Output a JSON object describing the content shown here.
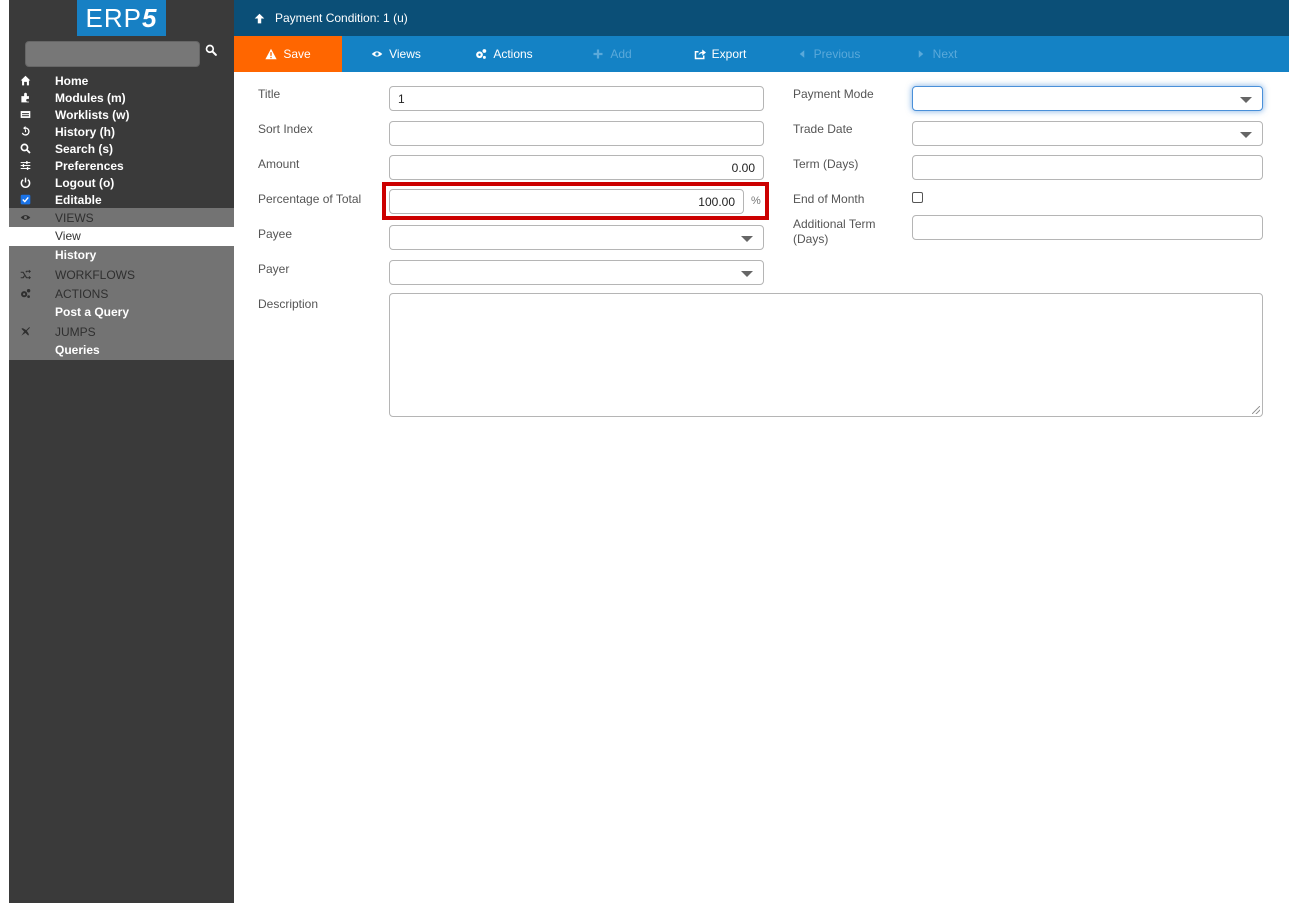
{
  "app": {
    "logo_text": "ERP",
    "logo_accent": "5"
  },
  "search": {
    "placeholder": "",
    "value": ""
  },
  "sidebar": {
    "items": [
      {
        "label": "Home",
        "icon": "home-icon"
      },
      {
        "label": "Modules (m)",
        "icon": "puzzle-icon"
      },
      {
        "label": "Worklists (w)",
        "icon": "worklist-icon"
      },
      {
        "label": "History (h)",
        "icon": "history-icon"
      },
      {
        "label": "Search (s)",
        "icon": "search-icon"
      },
      {
        "label": "Preferences",
        "icon": "sliders-icon"
      },
      {
        "label": "Logout (o)",
        "icon": "power-icon"
      },
      {
        "label": "Editable",
        "icon": "checkbox-checked-icon",
        "checked": true
      }
    ],
    "groups": [
      {
        "title": "VIEWS",
        "icon": "eye-icon",
        "items": [
          {
            "label": "View",
            "active": true
          },
          {
            "label": "History"
          }
        ]
      },
      {
        "title": "WORKFLOWS",
        "icon": "random-icon",
        "items": []
      },
      {
        "title": "ACTIONS",
        "icon": "cogs-icon",
        "items": [
          {
            "label": "Post a Query"
          }
        ]
      },
      {
        "title": "JUMPS",
        "icon": "plane-icon",
        "items": [
          {
            "label": "Queries"
          }
        ]
      }
    ]
  },
  "header": {
    "title": "Payment Condition: 1 (u)"
  },
  "toolbar": {
    "save": "Save",
    "views": "Views",
    "actions": "Actions",
    "add": "Add",
    "export": "Export",
    "previous": "Previous",
    "next": "Next"
  },
  "form": {
    "left": {
      "title": {
        "label": "Title",
        "value": "1"
      },
      "sort_index": {
        "label": "Sort Index",
        "value": ""
      },
      "amount": {
        "label": "Amount",
        "value": "0.00"
      },
      "percentage": {
        "label": "Percentage of Total",
        "value": "100.00",
        "suffix": "%"
      },
      "payee": {
        "label": "Payee",
        "value": ""
      },
      "payer": {
        "label": "Payer",
        "value": ""
      },
      "description": {
        "label": "Description",
        "value": ""
      }
    },
    "right": {
      "payment_mode": {
        "label": "Payment Mode",
        "value": ""
      },
      "trade_date": {
        "label": "Trade Date",
        "value": ""
      },
      "term_days": {
        "label": "Term (Days)",
        "value": ""
      },
      "end_of_month": {
        "label": "End of Month",
        "checked": false
      },
      "additional_term": {
        "label": "Additional Term (Days)",
        "value": ""
      }
    }
  },
  "colors": {
    "topbar": "#0b4f77",
    "toolbar": "#1482c5",
    "save": "#ff6600",
    "highlight": "#cc0000",
    "sidebar": "#3a3a3a",
    "logo": "#1780c4"
  }
}
